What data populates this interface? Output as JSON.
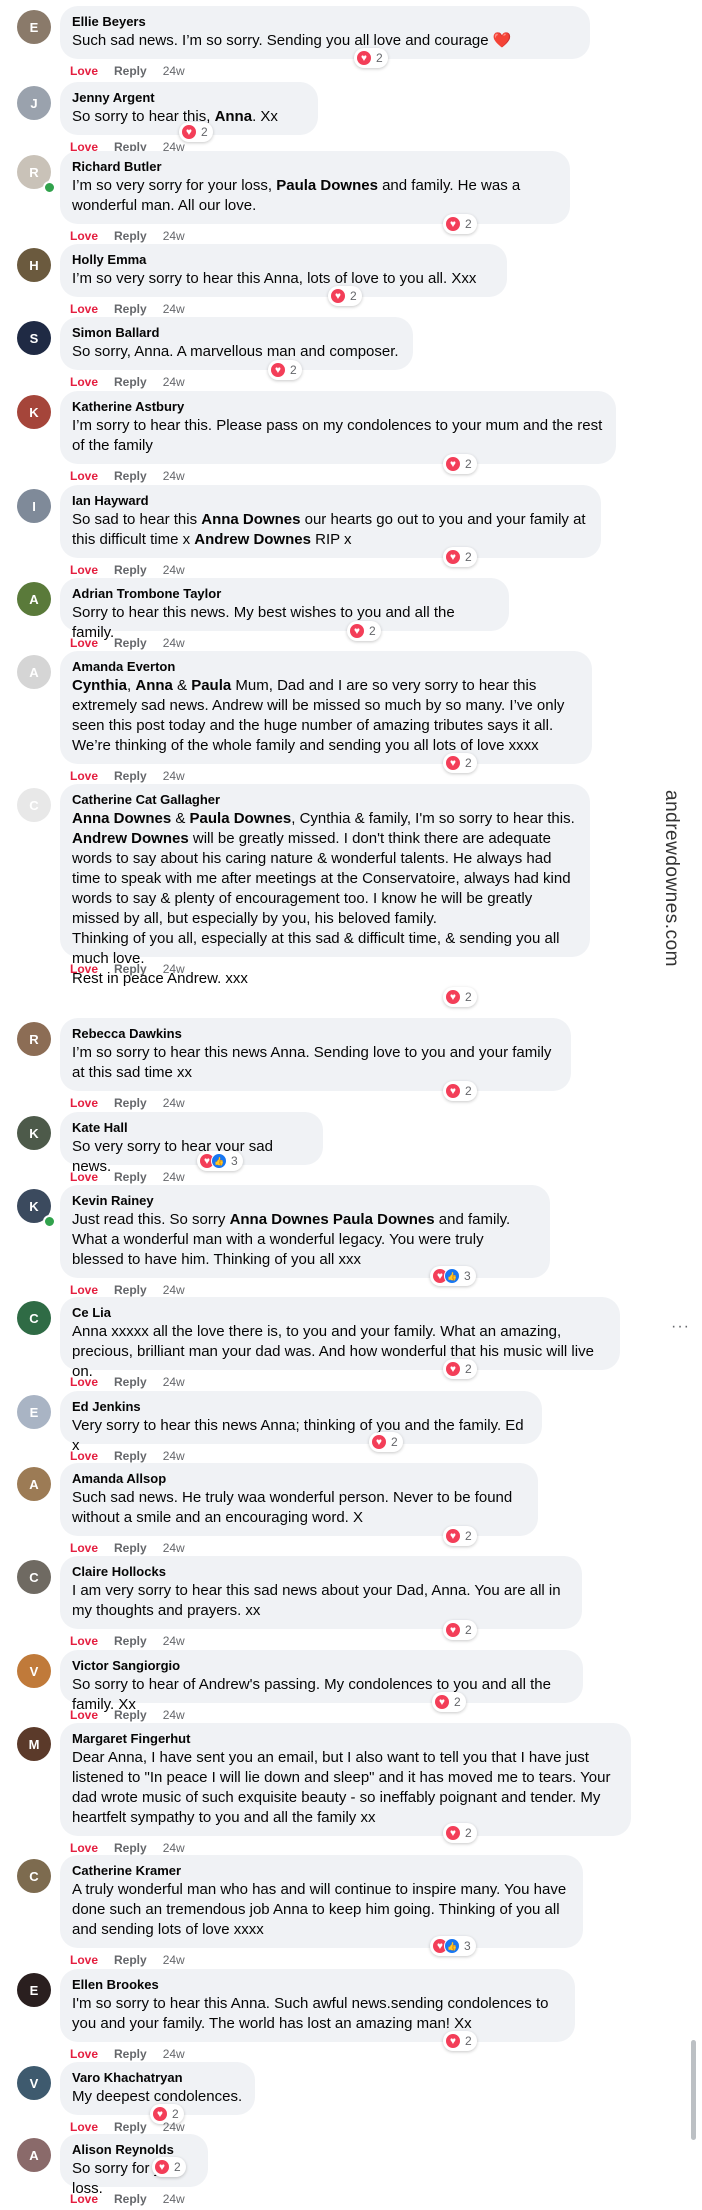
{
  "labels": {
    "love": "Love",
    "reply": "Reply"
  },
  "watermark": "andrewdownes.com",
  "more_options": "···",
  "comments": [
    {
      "author": "Ellie Beyers",
      "initial": "E",
      "avatar_color": "#8a7a6a",
      "time": "24w",
      "reactions": {
        "heart": true,
        "like": false,
        "count": "2"
      },
      "text": [
        {
          "t": "Such sad news. I’m so sorry. Sending you all love and courage ❤️"
        }
      ]
    },
    {
      "author": "Jenny Argent",
      "initial": "J",
      "avatar_color": "#9aa2ad",
      "time": "24w",
      "reactions": {
        "heart": true,
        "like": false,
        "count": "2"
      },
      "text": [
        {
          "t": "So sorry to hear this, "
        },
        {
          "t": "Anna",
          "b": true
        },
        {
          "t": ". Xx"
        }
      ]
    },
    {
      "author": "Richard Butler",
      "initial": "R",
      "avatar_color": "#c9c2b8",
      "time": "24w",
      "online": true,
      "reactions": {
        "heart": true,
        "like": false,
        "count": "2"
      },
      "text": [
        {
          "t": "I’m so very sorry for your loss, "
        },
        {
          "t": "Paula Downes",
          "b": true
        },
        {
          "t": " and family. He was a wonderful man. All our love."
        }
      ]
    },
    {
      "author": "Holly Emma",
      "initial": "H",
      "avatar_color": "#6b5a3e",
      "time": "24w",
      "reactions": {
        "heart": true,
        "like": false,
        "count": "2"
      },
      "text": [
        {
          "t": "I’m so very sorry to hear this Anna, lots of love to you all. Xxx"
        }
      ]
    },
    {
      "author": "Simon Ballard",
      "initial": "S",
      "avatar_color": "#1f2a44",
      "time": "24w",
      "reactions": {
        "heart": true,
        "like": false,
        "count": "2"
      },
      "text": [
        {
          "t": "So sorry, Anna. A marvellous man and composer."
        }
      ]
    },
    {
      "author": "Katherine Astbury",
      "initial": "K",
      "avatar_color": "#a5453a",
      "time": "24w",
      "reactions": {
        "heart": true,
        "like": false,
        "count": "2"
      },
      "text": [
        {
          "t": "I’m sorry to hear this. Please pass on my condolences to your mum and the rest of the family"
        }
      ]
    },
    {
      "author": "Ian Hayward",
      "initial": "I",
      "avatar_color": "#7f8a99",
      "time": "24w",
      "reactions": {
        "heart": true,
        "like": false,
        "count": "2"
      },
      "text": [
        {
          "t": "So sad to hear this "
        },
        {
          "t": "Anna Downes",
          "b": true
        },
        {
          "t": " our hearts go out to you and your family at this difficult time x "
        },
        {
          "t": "Andrew Downes",
          "b": true
        },
        {
          "t": " RIP x"
        }
      ]
    },
    {
      "author": "Adrian Trombone Taylor",
      "initial": "A",
      "avatar_color": "#5a7a3a",
      "time": "24w",
      "reactions": {
        "heart": true,
        "like": false,
        "count": "2"
      },
      "text": [
        {
          "t": "Sorry to hear this news. My best wishes to you and all the family."
        }
      ]
    },
    {
      "author": "Amanda Everton",
      "initial": "A",
      "avatar_color": "#d5d5d5",
      "time": "24w",
      "reactions": {
        "heart": true,
        "like": false,
        "count": "2"
      },
      "text": [
        {
          "t": "Cynthia",
          "b": true
        },
        {
          "t": ", "
        },
        {
          "t": "Anna",
          "b": true
        },
        {
          "t": " & "
        },
        {
          "t": "Paula",
          "b": true
        },
        {
          "t": " Mum, Dad and I are so very sorry to hear this extremely sad news. Andrew will be missed so much by so many. I’ve only seen this post today and the huge number of amazing tributes says it all. We’re thinking of the whole family and sending you all lots of love xxxx"
        }
      ]
    },
    {
      "author": "Catherine Cat Gallagher",
      "initial": "C",
      "avatar_color": "#e8e8e8",
      "time": "24w",
      "reactions": {
        "heart": true,
        "like": false,
        "count": "2"
      },
      "text": [
        {
          "t": "Anna Downes",
          "b": true
        },
        {
          "t": " & "
        },
        {
          "t": "Paula Downes",
          "b": true
        },
        {
          "t": ", Cynthia & family, I'm so sorry to hear this. "
        },
        {
          "t": "Andrew Downes",
          "b": true
        },
        {
          "t": " will be greatly missed. I don't think there are adequate words to say about his caring nature & wonderful talents. He always had time to speak with me after meetings at the Conservatoire, always had kind words to say & plenty of encouragement too. I know he will be greatly missed by all, but especially by you, his beloved family.\nThinking of you all, especially at this sad & difficult time, & sending you all much love.\nRest in peace Andrew. xxx"
        }
      ]
    },
    {
      "author": "Rebecca Dawkins",
      "initial": "R",
      "avatar_color": "#8c6d55",
      "time": "24w",
      "reactions": {
        "heart": true,
        "like": false,
        "count": "2"
      },
      "text": [
        {
          "t": "I’m so sorry to hear this news Anna. Sending love to you and your family at this sad time xx"
        }
      ]
    },
    {
      "author": "Kate Hall",
      "initial": "K",
      "avatar_color": "#4d5a4a",
      "time": "24w",
      "reactions": {
        "heart": true,
        "like": true,
        "count": "3"
      },
      "text": [
        {
          "t": "So very sorry to hear your sad news."
        }
      ]
    },
    {
      "author": "Kevin Rainey",
      "initial": "K",
      "avatar_color": "#3b4a5e",
      "time": "24w",
      "online": true,
      "reactions": {
        "heart": true,
        "like": true,
        "count": "3"
      },
      "text": [
        {
          "t": "Just read this. So sorry "
        },
        {
          "t": "Anna Downes",
          "b": true
        },
        {
          "t": " "
        },
        {
          "t": "Paula Downes",
          "b": true
        },
        {
          "t": " and family. What a wonderful man with a wonderful legacy. You were truly blessed to have him. Thinking of you all xxx"
        }
      ]
    },
    {
      "author": "Ce Lia",
      "initial": "C",
      "avatar_color": "#2f6b45",
      "time": "24w",
      "reactions": {
        "heart": true,
        "like": false,
        "count": "2"
      },
      "text": [
        {
          "t": "Anna xxxxx all the love there is, to you and your family. What an amazing, precious, brilliant man your dad was. And how wonderful that his music will live on."
        }
      ]
    },
    {
      "author": "Ed Jenkins",
      "initial": "E",
      "avatar_color": "#a9b4c4",
      "time": "24w",
      "reactions": {
        "heart": true,
        "like": false,
        "count": "2"
      },
      "text": [
        {
          "t": "Very sorry to hear this news Anna; thinking of you and the family. Ed x"
        }
      ]
    },
    {
      "author": "Amanda Allsop",
      "initial": "A",
      "avatar_color": "#9c7b55",
      "time": "24w",
      "reactions": {
        "heart": true,
        "like": false,
        "count": "2"
      },
      "text": [
        {
          "t": "Such sad news. He truly waa wonderful person. Never to be found without a smile and an encouraging word. X"
        }
      ]
    },
    {
      "author": "Claire Hollocks",
      "initial": "C",
      "avatar_color": "#6f6a62",
      "time": "24w",
      "reactions": {
        "heart": true,
        "like": false,
        "count": "2"
      },
      "text": [
        {
          "t": "I am very sorry to hear this sad news about your Dad, Anna. You are all in my thoughts and prayers. xx"
        }
      ]
    },
    {
      "author": "Victor Sangiorgio",
      "initial": "V",
      "avatar_color": "#c07a3a",
      "time": "24w",
      "reactions": {
        "heart": true,
        "like": false,
        "count": "2"
      },
      "text": [
        {
          "t": "So sorry to hear of Andrew's passing. My condolences to you and all the family. Xx"
        }
      ]
    },
    {
      "author": "Margaret Fingerhut",
      "initial": "M",
      "avatar_color": "#5b3a2a",
      "time": "24w",
      "reactions": {
        "heart": true,
        "like": false,
        "count": "2"
      },
      "text": [
        {
          "t": "Dear Anna, I have sent you an email, but I also want to tell you that I have just listened to \"In peace I will lie down and sleep\" and it has moved me to tears. Your dad wrote music of such exquisite beauty - so ineffably poignant and tender. My heartfelt sympathy to you and all the family xx"
        }
      ]
    },
    {
      "author": "Catherine Kramer",
      "initial": "C",
      "avatar_color": "#7d6b4f",
      "time": "24w",
      "reactions": {
        "heart": true,
        "like": true,
        "count": "3"
      },
      "text": [
        {
          "t": "A truly wonderful man who has and will continue to inspire many. You have done such an tremendous job Anna to keep him going. Thinking of you all and sending lots of love xxxx"
        }
      ]
    },
    {
      "author": "Ellen Brookes",
      "initial": "E",
      "avatar_color": "#2a1f1f",
      "time": "24w",
      "reactions": {
        "heart": true,
        "like": false,
        "count": "2"
      },
      "text": [
        {
          "t": "I'm so sorry to hear this Anna. Such awful news.sending condolences to you and your family. The world has lost an amazing man! Xx"
        }
      ]
    },
    {
      "author": "Varo Khachatryan",
      "initial": "V",
      "avatar_color": "#3e5a6e",
      "time": "24w",
      "reactions": {
        "heart": true,
        "like": false,
        "count": "2"
      },
      "text": [
        {
          "t": "My deepest condolences."
        }
      ]
    },
    {
      "author": "Alison Reynolds",
      "initial": "A",
      "avatar_color": "#8a6a6a",
      "time": "24w",
      "reactions": {
        "heart": true,
        "like": false,
        "count": "2"
      },
      "text": [
        {
          "t": "So sorry for your loss."
        }
      ]
    }
  ]
}
